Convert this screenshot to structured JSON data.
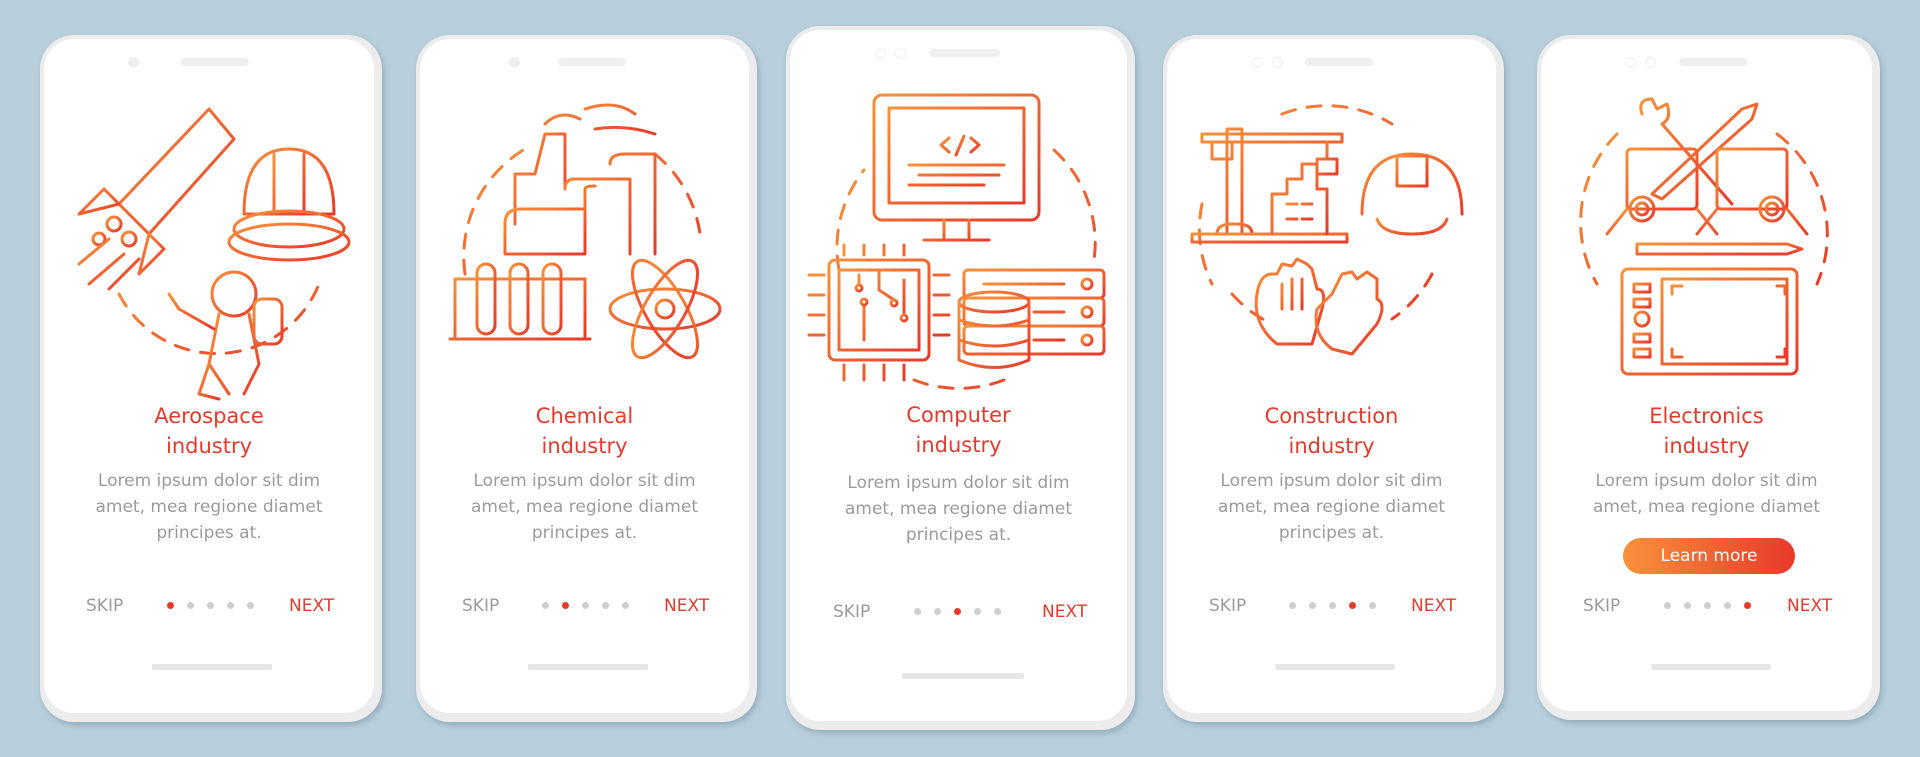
{
  "colors": {
    "background": "#b8cfdb",
    "accent_red": "#e23b2d",
    "gradient_start": "#f7923a",
    "gradient_end": "#e8392a",
    "text_gray": "#9b9b9b",
    "dot_inactive": "#cfcfcf"
  },
  "common": {
    "skip_label": "SKIP",
    "next_label": "NEXT",
    "total_pages": 5
  },
  "screens": [
    {
      "illustration": "aerospace-illustration",
      "title_line1": "Aerospace",
      "title_line2": "industry",
      "body_line1": "Lorem ipsum dolor sit dim",
      "body_line2": "amet, mea regione diamet",
      "body_line3": "principes at.",
      "active_page": 1
    },
    {
      "illustration": "chemical-illustration",
      "title_line1": "Chemical",
      "title_line2": "industry",
      "body_line1": "Lorem ipsum dolor sit dim",
      "body_line2": "amet, mea regione diamet",
      "body_line3": "principes at.",
      "active_page": 2
    },
    {
      "illustration": "computer-illustration",
      "title_line1": "Computer",
      "title_line2": "industry",
      "body_line1": "Lorem ipsum dolor sit dim",
      "body_line2": "amet, mea regione diamet",
      "body_line3": "principes at.",
      "active_page": 3
    },
    {
      "illustration": "construction-illustration",
      "title_line1": "Construction",
      "title_line2": "industry",
      "body_line1": "Lorem ipsum dolor sit dim",
      "body_line2": "amet, mea regione diamet",
      "body_line3": "principes at.",
      "active_page": 4
    },
    {
      "illustration": "electronics-illustration",
      "title_line1": "Electronics",
      "title_line2": "industry",
      "body_line1": "Lorem ipsum dolor sit dim",
      "body_line2": "amet, mea regione diamet",
      "learn_more_label": "Learn more",
      "active_page": 5
    }
  ]
}
